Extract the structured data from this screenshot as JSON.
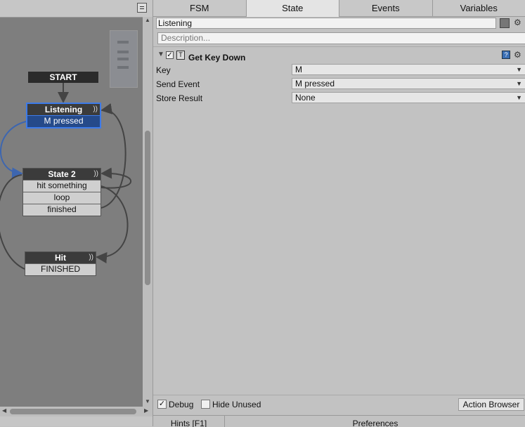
{
  "graph": {
    "nodes": {
      "start": {
        "title": "START"
      },
      "listening": {
        "title": "Listening",
        "events": [
          "M pressed"
        ]
      },
      "state2": {
        "title": "State 2",
        "events": [
          "hit something",
          "loop",
          "finished"
        ]
      },
      "hit": {
        "title": "Hit",
        "events": [
          "FINISHED"
        ]
      }
    },
    "selected_color": "#3d7bea"
  },
  "tabs": [
    "FSM",
    "State",
    "Events",
    "Variables"
  ],
  "active_tab": "State",
  "state": {
    "name": "Listening",
    "description_placeholder": "Description..."
  },
  "action": {
    "title": "Get Key Down",
    "enabled": true,
    "properties": [
      {
        "label": "Key",
        "value": "M"
      },
      {
        "label": "Send Event",
        "value": "M pressed"
      },
      {
        "label": "Store Result",
        "value": "None"
      }
    ]
  },
  "bottom": {
    "debug_label": "Debug",
    "debug_checked": true,
    "hide_unused_label": "Hide Unused",
    "hide_unused_checked": false,
    "action_browser_label": "Action Browser"
  },
  "footer": {
    "hints_label": "Hints [F1]",
    "preferences_label": "Preferences"
  }
}
